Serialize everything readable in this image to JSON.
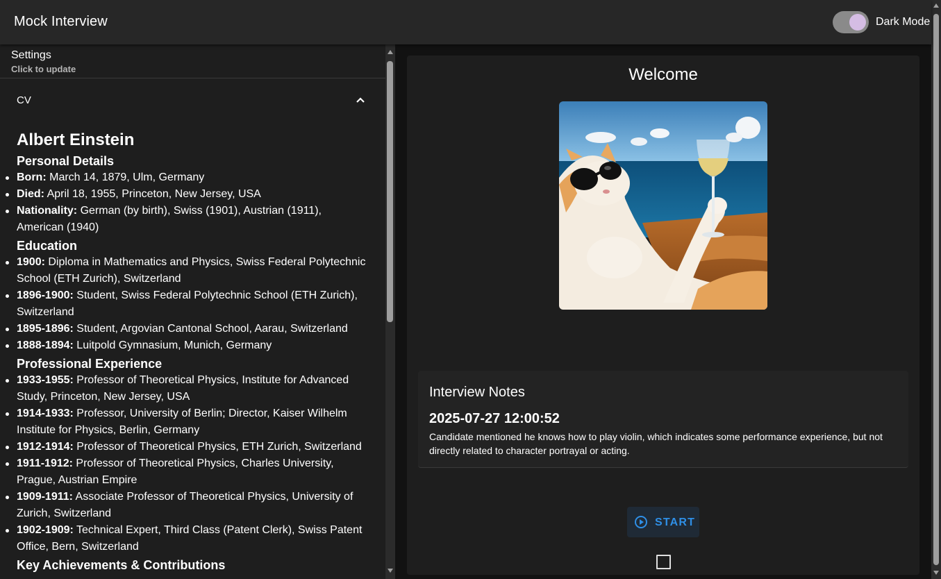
{
  "app": {
    "title": "Mock Interview",
    "dark_mode_label": "Dark Mode",
    "dark_mode_on": true
  },
  "settings": {
    "title": "Settings",
    "subtitle": "Click to update"
  },
  "cv": {
    "label": "CV",
    "name": "Albert Einstein",
    "sections": [
      {
        "heading": "Personal Details",
        "items": [
          {
            "key": "Born:",
            "text": "March 14, 1879, Ulm, Germany"
          },
          {
            "key": "Died:",
            "text": "April 18, 1955, Princeton, New Jersey, USA"
          },
          {
            "key": "Nationality:",
            "text": "German (by birth), Swiss (1901), Austrian (1911), American (1940)"
          }
        ]
      },
      {
        "heading": "Education",
        "items": [
          {
            "key": "1900:",
            "text": "Diploma in Mathematics and Physics, Swiss Federal Polytechnic School (ETH Zurich), Switzerland"
          },
          {
            "key": "1896-1900:",
            "text": "Student, Swiss Federal Polytechnic School (ETH Zurich), Switzerland"
          },
          {
            "key": "1895-1896:",
            "text": "Student, Argovian Cantonal School, Aarau, Switzerland"
          },
          {
            "key": "1888-1894:",
            "text": "Luitpold Gymnasium, Munich, Germany"
          }
        ]
      },
      {
        "heading": "Professional Experience",
        "items": [
          {
            "key": "1933-1955:",
            "text": "Professor of Theoretical Physics, Institute for Advanced Study, Princeton, New Jersey, USA"
          },
          {
            "key": "1914-1933:",
            "text": "Professor, University of Berlin; Director, Kaiser Wilhelm Institute for Physics, Berlin, Germany"
          },
          {
            "key": "1912-1914:",
            "text": "Professor of Theoretical Physics, ETH Zurich, Switzerland"
          },
          {
            "key": "1911-1912:",
            "text": "Professor of Theoretical Physics, Charles University, Prague, Austrian Empire"
          },
          {
            "key": "1909-1911:",
            "text": "Associate Professor of Theoretical Physics, University of Zurich, Switzerland"
          },
          {
            "key": "1902-1909:",
            "text": "Technical Expert, Third Class (Patent Clerk), Swiss Patent Office, Bern, Switzerland"
          }
        ]
      },
      {
        "heading": "Key Achievements & Contributions",
        "items": []
      }
    ]
  },
  "main": {
    "welcome": "Welcome",
    "notes_title": "Interview Notes",
    "notes": [
      {
        "timestamp": "2025-07-27 12:00:52",
        "text": "Candidate mentioned he knows how to play violin, which indicates some performance experience, but not directly related to character portrayal or acting."
      }
    ],
    "start_label": "START",
    "checkbox_checked": false
  },
  "colors": {
    "accent": "#2f8fe6",
    "toggle_knob": "#d5bde4"
  }
}
